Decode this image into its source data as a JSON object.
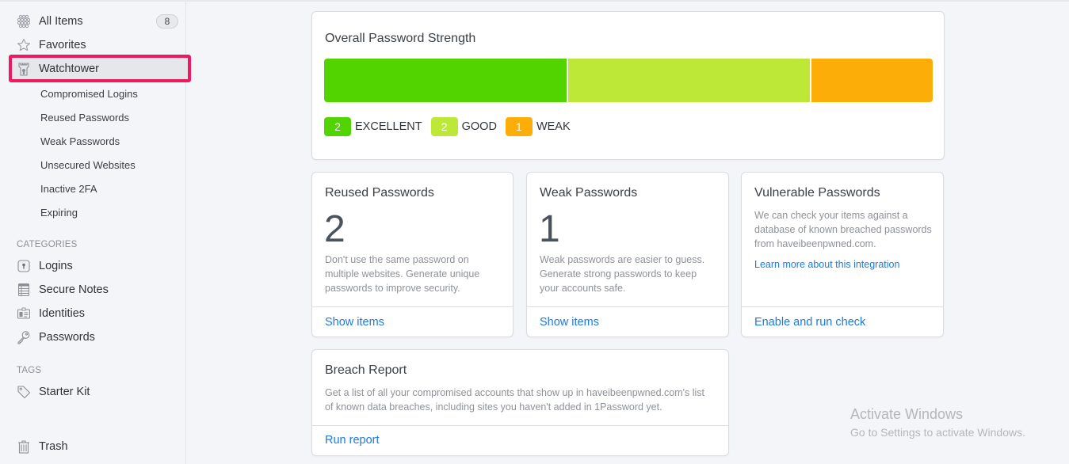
{
  "sidebar": {
    "main_items": [
      {
        "label": "All Items",
        "icon": "all-items-icon",
        "count": "8"
      },
      {
        "label": "Favorites",
        "icon": "star-icon"
      },
      {
        "label": "Watchtower",
        "icon": "watchtower-icon",
        "selected": true
      }
    ],
    "watchtower_subitems": [
      {
        "label": "Compromised Logins"
      },
      {
        "label": "Reused Passwords"
      },
      {
        "label": "Weak Passwords"
      },
      {
        "label": "Unsecured Websites"
      },
      {
        "label": "Inactive 2FA"
      },
      {
        "label": "Expiring"
      }
    ],
    "categories_header": "CATEGORIES",
    "categories": [
      {
        "label": "Logins",
        "icon": "login-icon"
      },
      {
        "label": "Secure Notes",
        "icon": "secure-note-icon"
      },
      {
        "label": "Identities",
        "icon": "identity-icon"
      },
      {
        "label": "Passwords",
        "icon": "key-icon"
      }
    ],
    "tags_header": "TAGS",
    "tags": [
      {
        "label": "Starter Kit",
        "icon": "tag-icon"
      }
    ],
    "trash": {
      "label": "Trash",
      "icon": "trash-icon"
    }
  },
  "strength": {
    "title": "Overall Password Strength",
    "segments": [
      {
        "label": "EXCELLENT",
        "count": "2",
        "value": 2,
        "color": "#52d400"
      },
      {
        "label": "GOOD",
        "count": "2",
        "value": 2,
        "color": "#bde838"
      },
      {
        "label": "WEAK",
        "count": "1",
        "value": 1,
        "color": "#fdad08"
      }
    ]
  },
  "cards": {
    "reused": {
      "title": "Reused Passwords",
      "count": "2",
      "description_lines": [
        "Don't use the same password on",
        "multiple websites. Generate unique",
        "passwords to improve security."
      ],
      "action": "Show items"
    },
    "weak": {
      "title": "Weak Passwords",
      "count": "1",
      "description_lines": [
        "Weak passwords are easier to guess.",
        "Generate strong passwords to keep",
        "your accounts safe."
      ],
      "action": "Show items"
    },
    "vulnerable": {
      "title": "Vulnerable Passwords",
      "description_lines": [
        "We can check your items against a",
        "database of known breached passwords",
        "from haveibeenpwned.com."
      ],
      "learn_more": "Learn more about this integration",
      "action": "Enable and run check"
    },
    "breach": {
      "title": "Breach Report",
      "description_lines": [
        "Get a list of all your compromised accounts that show up in haveibeenpwned.com's list",
        "of known data breaches, including sites you haven't added in 1Password yet."
      ],
      "action": "Run report"
    }
  },
  "watermark": {
    "title": "Activate Windows",
    "subtitle": "Go to Settings to activate Windows."
  },
  "colors": {
    "accent_link": "#1a7ae6",
    "selection_outline": "#f0185e"
  }
}
